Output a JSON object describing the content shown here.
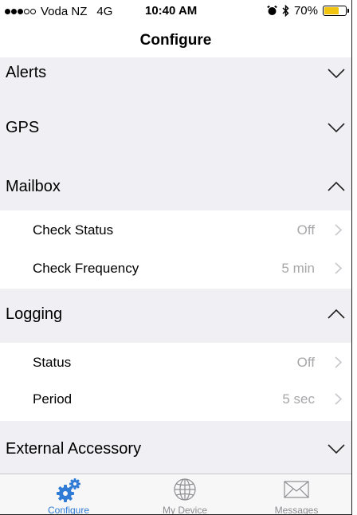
{
  "status_bar": {
    "carrier": "Voda NZ",
    "network": "4G",
    "time": "10:40 AM",
    "battery": "70%",
    "battery_level": 0.7,
    "signal_dots_filled": 3,
    "signal_dots_total": 5,
    "icons": [
      "alarm-icon",
      "bluetooth-icon",
      "battery-icon"
    ],
    "battery_color": "#f1c40f"
  },
  "navbar": {
    "title": "Configure"
  },
  "sections": {
    "alerts": {
      "label": "Alerts",
      "state": "collapsed"
    },
    "gps": {
      "label": "GPS",
      "state": "collapsed"
    },
    "mailbox": {
      "label": "Mailbox",
      "state": "expanded",
      "rows": [
        {
          "label": "Check Status",
          "value": "Off"
        },
        {
          "label": "Check Frequency",
          "value": "5 min"
        }
      ]
    },
    "logging": {
      "label": "Logging",
      "state": "expanded",
      "rows": [
        {
          "label": "Status",
          "value": "Off"
        },
        {
          "label": "Period",
          "value": "5 sec"
        }
      ]
    },
    "external_accessory": {
      "label": "External Accessory",
      "state": "collapsed"
    }
  },
  "tabbar": {
    "tabs": [
      {
        "label": "Configure",
        "icon": "gears-icon",
        "active": true
      },
      {
        "label": "My Device",
        "icon": "globe-icon",
        "active": false
      },
      {
        "label": "Messages",
        "icon": "envelope-icon",
        "active": false
      }
    ],
    "active_color": "#2f7bd6",
    "inactive_color": "#8e8e93"
  },
  "colors": {
    "section_background": "#efeff4",
    "value_text": "#a7a7aa"
  }
}
